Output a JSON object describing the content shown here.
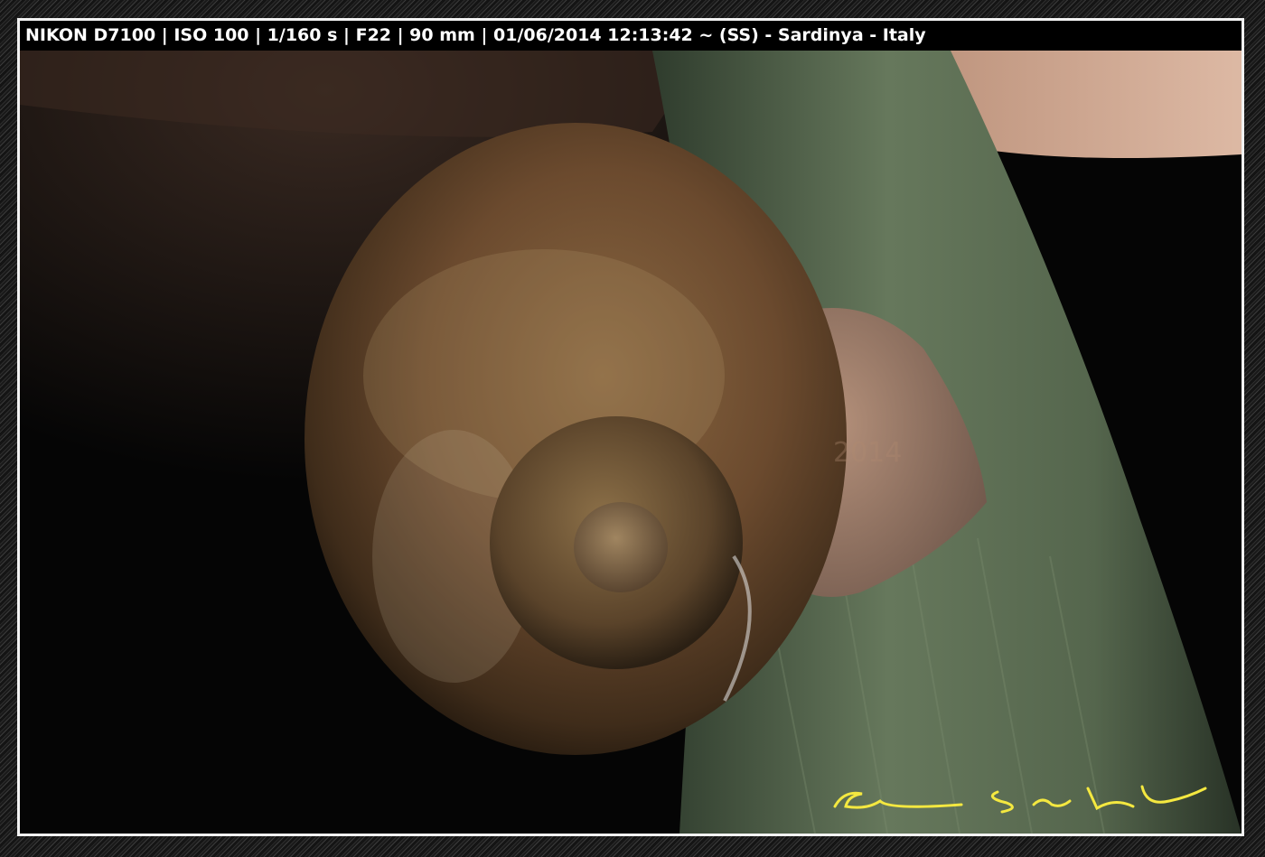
{
  "exif": {
    "caption": "NIKON D7100 | ISO 100 | 1/160 s | F22 | 90 mm | 01/06/2014 12:13:42  ~   (SS) - Sardinya - Italy"
  },
  "photo": {
    "subject": "snail-shell-on-green-stem",
    "watermark": "2014"
  },
  "colors": {
    "frame_light": "#f2f2f2",
    "bar": "#000000",
    "shell": "#6b4a2e",
    "stem": "#5c6e55",
    "signature": "#f4e840"
  }
}
